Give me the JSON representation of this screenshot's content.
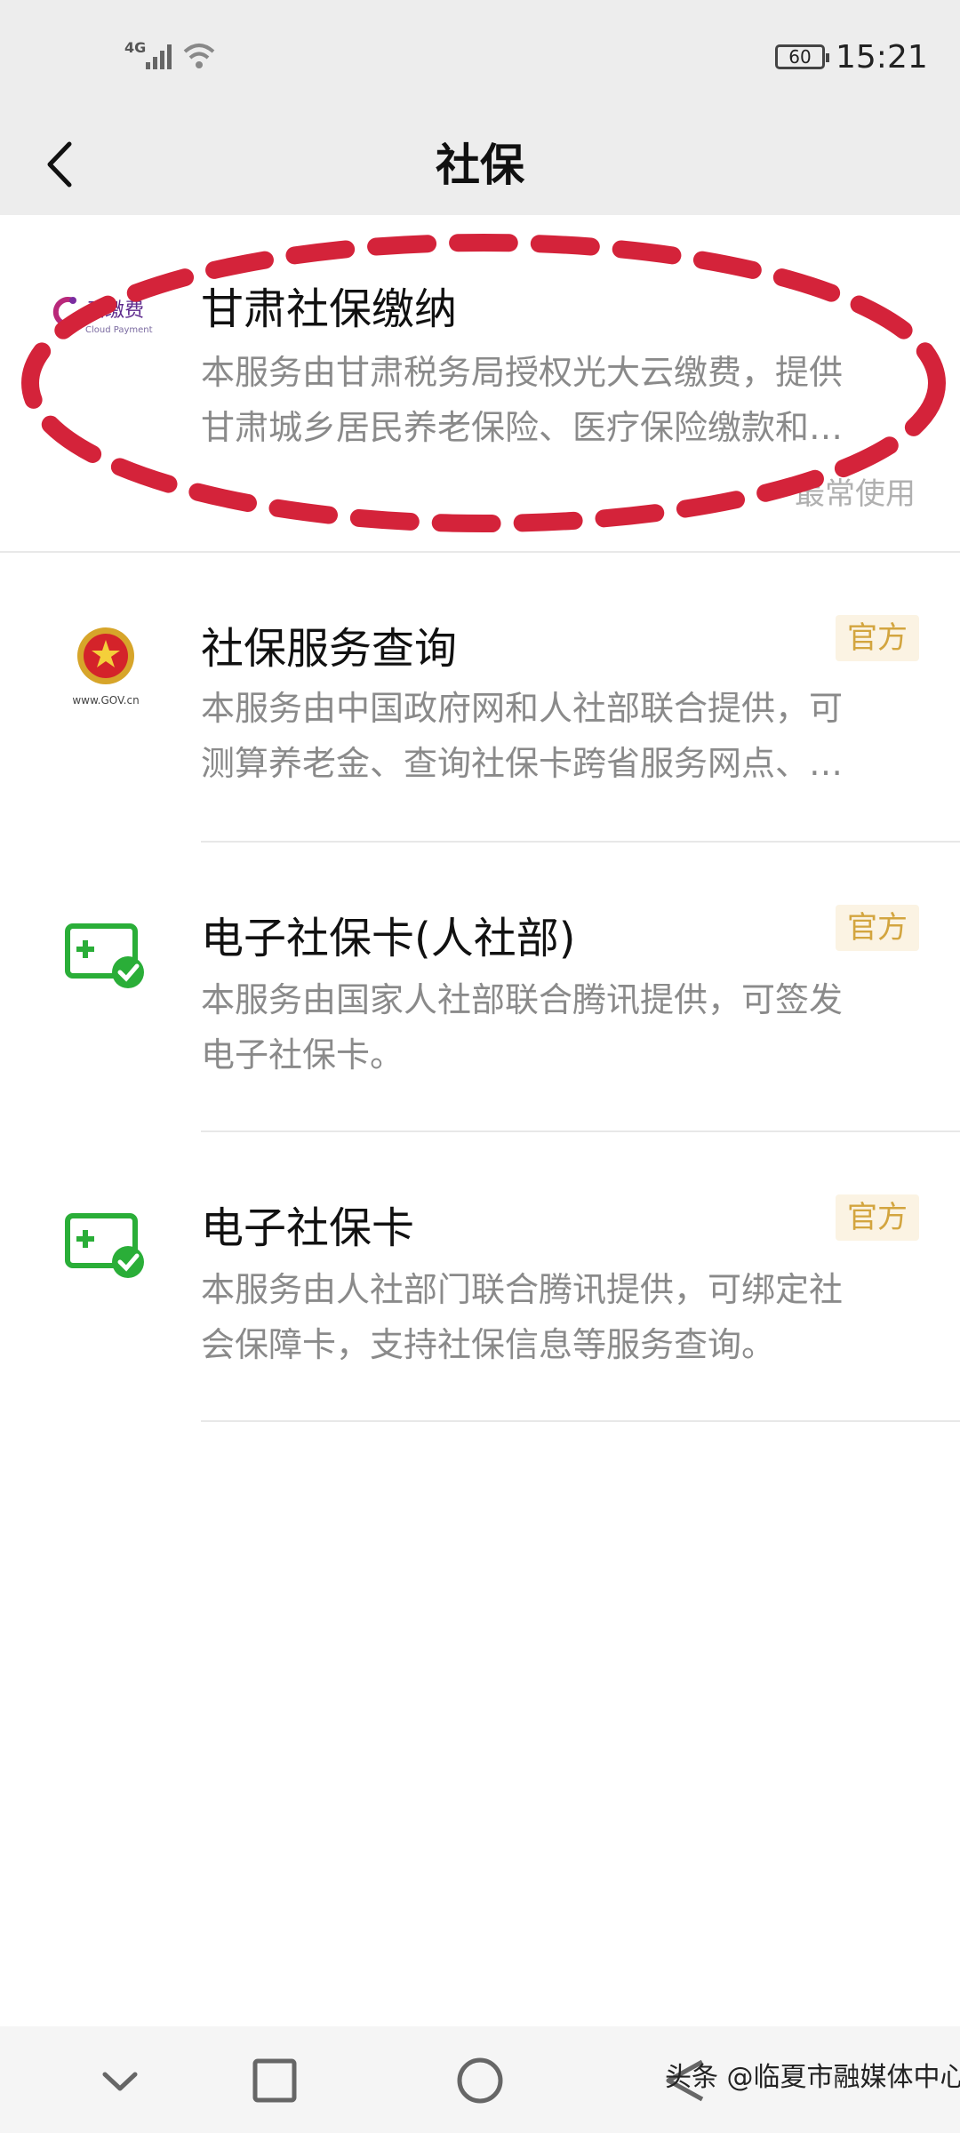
{
  "status_bar": {
    "network": "4G",
    "battery": "60",
    "time": "15:21"
  },
  "nav": {
    "title": "社保"
  },
  "services": [
    {
      "title": "甘肃社保缴纳",
      "desc_line1": "本服务由甘肃税务局授权光大云缴费，提供",
      "desc_line2": "甘肃城乡居民养老保险、医疗保险缴款和…",
      "meta": "最常使用",
      "icon_text": "云缴费",
      "icon_subtext": "Cloud Payment",
      "icon": "cloud-payment-logo"
    },
    {
      "title": "社保服务查询",
      "badge": "官方",
      "desc_line1": "本服务由中国政府网和人社部联合提供，可",
      "desc_line2": "测算养老金、查询社保卡跨省服务网点、…",
      "icon_text": "www.GOV.cn",
      "icon": "national-emblem-icon"
    },
    {
      "title": "电子社保卡(人社部)",
      "badge": "官方",
      "desc_line1": "本服务由国家人社部联合腾讯提供，可签发",
      "desc_line2": "电子社保卡。",
      "icon": "social-security-card-icon"
    },
    {
      "title": "电子社保卡",
      "badge": "官方",
      "desc_line1": "本服务由人社部门联合腾讯提供，可绑定社",
      "desc_line2": "会保障卡，支持社保信息等服务查询。",
      "icon": "social-security-card-icon"
    }
  ],
  "watermark": "头条 @临夏市融媒体中心",
  "colors": {
    "highlight": "#d4233a",
    "badge_text": "#d3a53f",
    "badge_bg": "#fbf3e3",
    "card_green": "#2aae38"
  }
}
